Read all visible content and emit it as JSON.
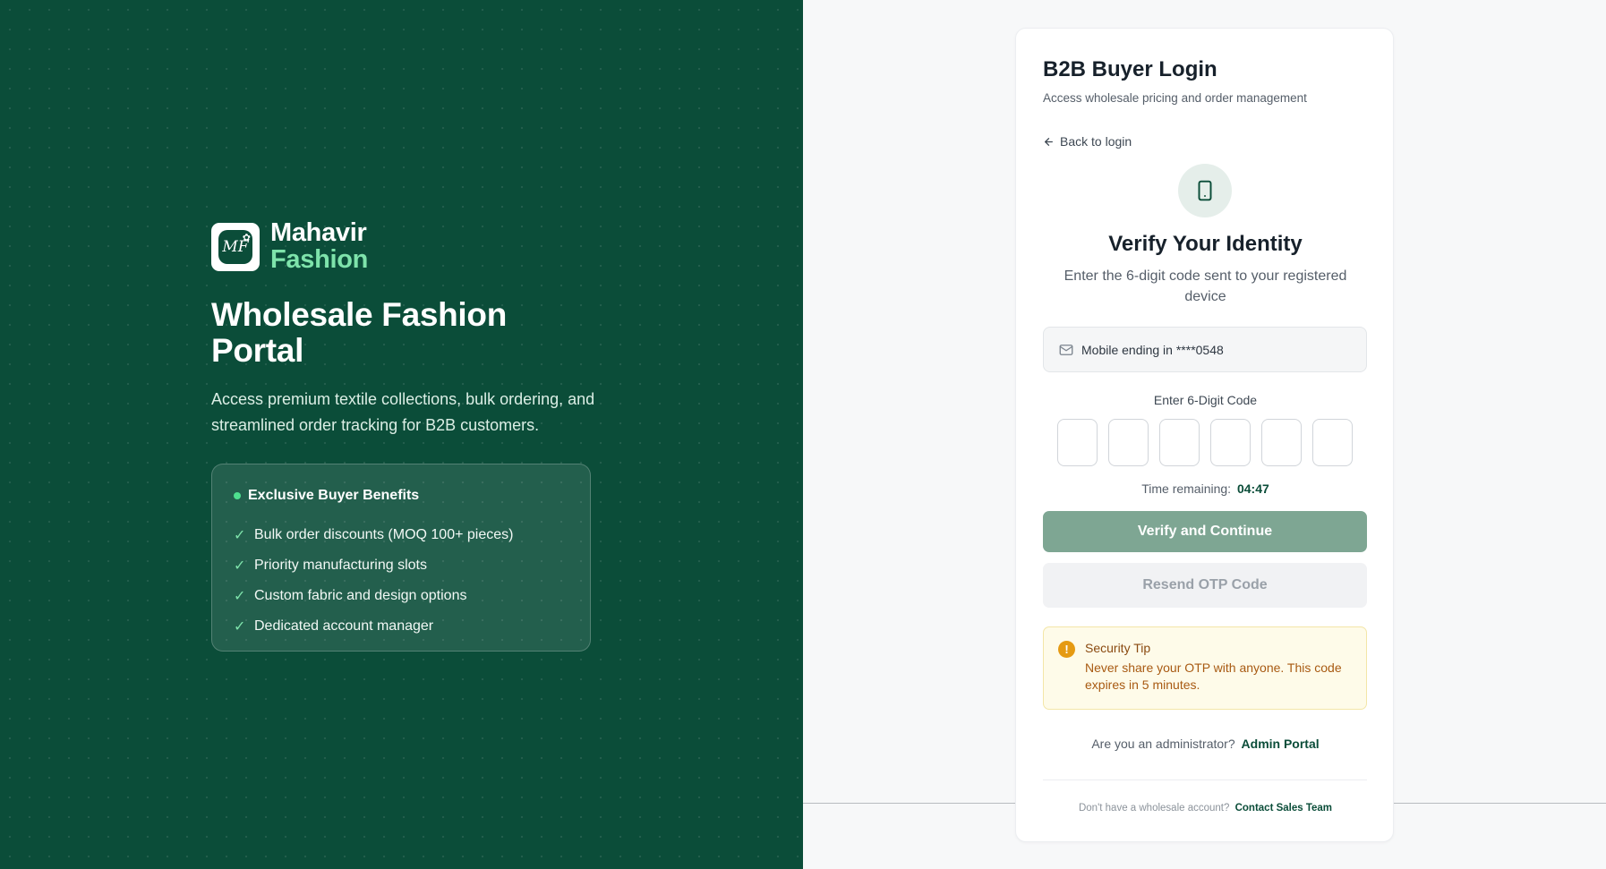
{
  "brand": {
    "logo_monogram": "MF",
    "name": "Mahavir",
    "sub": "Fashion"
  },
  "hero": {
    "headline": "Wholesale Fashion Portal",
    "description": "Access premium textile collections, bulk ordering, and streamlined order tracking for B2B customers."
  },
  "benefits": {
    "title": "Exclusive Buyer Benefits",
    "items": [
      "Bulk order discounts (MOQ 100+ pieces)",
      "Priority manufacturing slots",
      "Custom fabric and design options",
      "Dedicated account manager"
    ]
  },
  "login": {
    "title": "B2B Buyer Login",
    "subtitle": "Access wholesale pricing and order management",
    "back_label": "Back to login"
  },
  "verify": {
    "title": "Verify Your Identity",
    "subtitle": "Enter the 6-digit code sent to your registered device",
    "mobile_text": "Mobile ending in ****0548",
    "code_label": "Enter 6-Digit Code",
    "otp_digits": [
      "",
      "",
      "",
      "",
      "",
      ""
    ],
    "timer_label": "Time remaining:",
    "timer_value": "04:47",
    "verify_button": "Verify and Continue",
    "resend_button": "Resend OTP Code"
  },
  "security_tip": {
    "title": "Security Tip",
    "text": "Never share your OTP with anyone. This code expires in 5 minutes."
  },
  "footer": {
    "admin_prompt": "Are you an administrator?",
    "admin_link": "Admin Portal",
    "contact_prompt": "Don't have a wholesale account?",
    "contact_link": "Contact Sales Team"
  },
  "colors": {
    "brand_green": "#0b4d39",
    "accent_green": "#7ee3ab",
    "verify_button_bg": "#7ea693",
    "tip_icon": "#e59a12"
  },
  "icons": {
    "back": "arrow-left-icon",
    "device": "smartphone-icon",
    "mobile_box": "mail-icon",
    "tip": "alert-circle-icon",
    "benefit": "check-icon"
  }
}
